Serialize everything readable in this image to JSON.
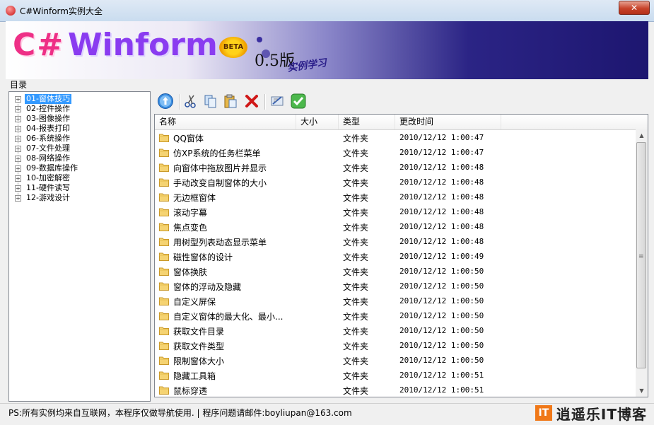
{
  "window": {
    "title": "C#Winform实例大全",
    "close": "✕"
  },
  "banner": {
    "logo_cs": "C#",
    "logo_win": "Winform",
    "beta": "BETA",
    "version": "0.5版",
    "study": "实例学习"
  },
  "tree": {
    "label": "目录",
    "items": [
      {
        "label": "01-窗体技巧",
        "selected": true
      },
      {
        "label": "02-控件操作"
      },
      {
        "label": "03-图像操作"
      },
      {
        "label": "04-报表打印"
      },
      {
        "label": "06-系统操作"
      },
      {
        "label": "07-文件处理"
      },
      {
        "label": "08-网络操作"
      },
      {
        "label": "09-数据库操作"
      },
      {
        "label": "10-加密解密"
      },
      {
        "label": "11-硬件读写"
      },
      {
        "label": "12-游戏设计"
      }
    ]
  },
  "toolbar": {
    "buttons": [
      {
        "icon": "up-arrow-icon"
      },
      {
        "icon": "cut-icon"
      },
      {
        "icon": "copy-icon"
      },
      {
        "icon": "paste-icon"
      },
      {
        "icon": "delete-icon"
      },
      {
        "icon": "properties-icon"
      },
      {
        "icon": "check-icon"
      }
    ]
  },
  "list": {
    "columns": [
      "名称",
      "大小",
      "类型",
      "更改时间"
    ],
    "rows": [
      {
        "name": "QQ窗体",
        "size": "",
        "type": "文件夹",
        "modified": "2010/12/12 1:00:47"
      },
      {
        "name": "仿XP系统的任务栏菜单",
        "size": "",
        "type": "文件夹",
        "modified": "2010/12/12 1:00:47"
      },
      {
        "name": "向窗体中拖放图片并显示",
        "size": "",
        "type": "文件夹",
        "modified": "2010/12/12 1:00:48"
      },
      {
        "name": "手动改变自制窗体的大小",
        "size": "",
        "type": "文件夹",
        "modified": "2010/12/12 1:00:48"
      },
      {
        "name": "无边框窗体",
        "size": "",
        "type": "文件夹",
        "modified": "2010/12/12 1:00:48"
      },
      {
        "name": "滚动字幕",
        "size": "",
        "type": "文件夹",
        "modified": "2010/12/12 1:00:48"
      },
      {
        "name": "焦点变色",
        "size": "",
        "type": "文件夹",
        "modified": "2010/12/12 1:00:48"
      },
      {
        "name": "用树型列表动态显示菜单",
        "size": "",
        "type": "文件夹",
        "modified": "2010/12/12 1:00:48"
      },
      {
        "name": "磁性窗体的设计",
        "size": "",
        "type": "文件夹",
        "modified": "2010/12/12 1:00:49"
      },
      {
        "name": "窗体换肤",
        "size": "",
        "type": "文件夹",
        "modified": "2010/12/12 1:00:50"
      },
      {
        "name": "窗体的浮动及隐藏",
        "size": "",
        "type": "文件夹",
        "modified": "2010/12/12 1:00:50"
      },
      {
        "name": "自定义屏保",
        "size": "",
        "type": "文件夹",
        "modified": "2010/12/12 1:00:50"
      },
      {
        "name": "自定义窗体的最大化、最小...",
        "size": "",
        "type": "文件夹",
        "modified": "2010/12/12 1:00:50"
      },
      {
        "name": "获取文件目录",
        "size": "",
        "type": "文件夹",
        "modified": "2010/12/12 1:00:50"
      },
      {
        "name": "获取文件类型",
        "size": "",
        "type": "文件夹",
        "modified": "2010/12/12 1:00:50"
      },
      {
        "name": "限制窗体大小",
        "size": "",
        "type": "文件夹",
        "modified": "2010/12/12 1:00:50"
      },
      {
        "name": "隐藏工具箱",
        "size": "",
        "type": "文件夹",
        "modified": "2010/12/12 1:00:51"
      },
      {
        "name": "鼠标穿透",
        "size": "",
        "type": "文件夹",
        "modified": "2010/12/12 1:00:51"
      }
    ]
  },
  "status": {
    "text": "PS:所有实例均来自互联网，本程序仅做导航使用. | 程序问题请邮件:boyliupan@163.com",
    "brand_icon": "IT",
    "brand_text": "逍遥乐IT博客"
  }
}
